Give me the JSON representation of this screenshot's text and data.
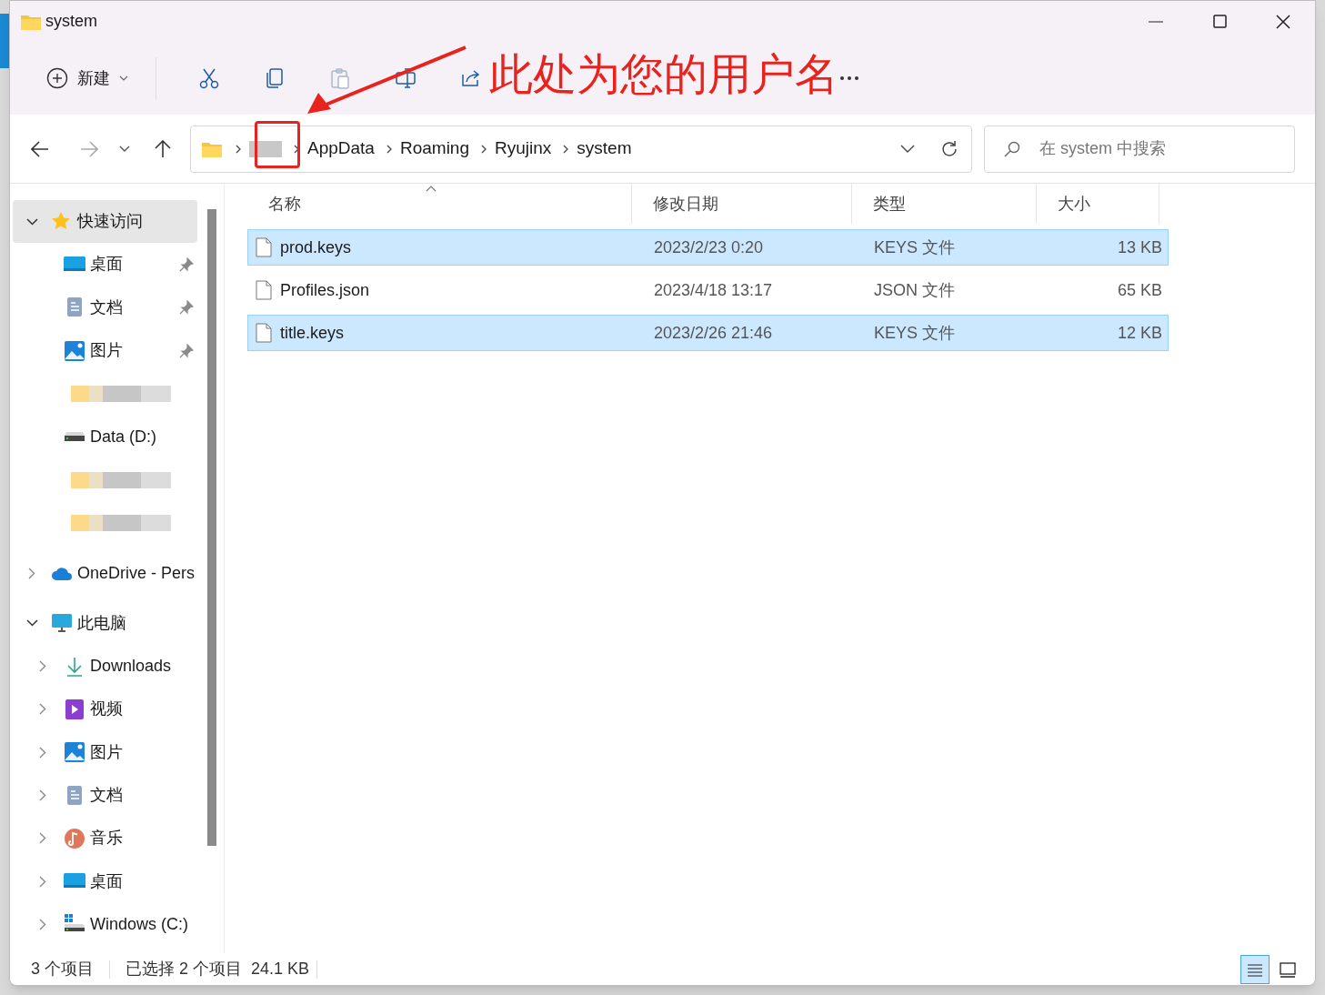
{
  "window": {
    "title": "system"
  },
  "toolbar": {
    "new_button": {
      "label": "新建"
    },
    "tools": [
      {
        "kind": "cut",
        "disabled": false
      },
      {
        "kind": "copy",
        "disabled": false
      },
      {
        "kind": "paste",
        "disabled": true
      },
      {
        "kind": "rename",
        "disabled": false
      },
      {
        "kind": "share",
        "disabled": false
      },
      {
        "kind": "more",
        "disabled": false
      }
    ]
  },
  "annotation": {
    "text": "此处为您的用户名"
  },
  "address_bar": {
    "segments": [
      {
        "kind": "redacted"
      },
      {
        "kind": "text",
        "label": "AppData"
      },
      {
        "kind": "text",
        "label": "Roaming"
      },
      {
        "kind": "text",
        "label": "Ryujinx"
      },
      {
        "kind": "text",
        "label": "system"
      }
    ]
  },
  "search": {
    "placeholder": "在 system 中搜索"
  },
  "sidebar": {
    "items": [
      {
        "kind": "star",
        "label": "快速访问",
        "expanded": true,
        "selected": true,
        "children": [
          {
            "kind": "desktop",
            "label": "桌面",
            "pinned": true,
            "selected": false
          },
          {
            "kind": "document",
            "label": "文档",
            "pinned": true,
            "selected": false
          },
          {
            "kind": "picture",
            "label": "图片",
            "pinned": true,
            "selected": false
          },
          {
            "kind": "redacted"
          },
          {
            "kind": "drive",
            "label": "Data (D:)",
            "pinned": false,
            "selected": false
          },
          {
            "kind": "redacted"
          },
          {
            "kind": "redacted"
          }
        ]
      },
      {
        "kind": "cloud",
        "label": "OneDrive - Pers",
        "expanded": false,
        "selected": false
      },
      {
        "kind": "computer",
        "label": "此电脑",
        "expanded": true,
        "selected": false,
        "children": [
          {
            "kind": "download",
            "label": "Downloads",
            "expanded": false,
            "selected": false
          },
          {
            "kind": "video",
            "label": "视频",
            "expanded": false,
            "selected": false
          },
          {
            "kind": "picture",
            "label": "图片",
            "expanded": false,
            "selected": false
          },
          {
            "kind": "document",
            "label": "文档",
            "expanded": false,
            "selected": false
          },
          {
            "kind": "music",
            "label": "音乐",
            "expanded": false,
            "selected": false
          },
          {
            "kind": "desktop",
            "label": "桌面",
            "expanded": false,
            "selected": false
          },
          {
            "kind": "windows-drive",
            "label": "Windows (C:)",
            "expanded": false,
            "selected": false
          }
        ]
      }
    ]
  },
  "table": {
    "columns": [
      {
        "label": "名称",
        "sorted": true
      },
      {
        "label": "修改日期",
        "sorted": false
      },
      {
        "label": "类型",
        "sorted": false
      },
      {
        "label": "大小",
        "sorted": false
      }
    ],
    "rows": [
      {
        "name": "prod.keys",
        "date": "2023/2/23 0:20",
        "type": "KEYS 文件",
        "size": "13 KB",
        "selected": true
      },
      {
        "name": "Profiles.json",
        "date": "2023/4/18 13:17",
        "type": "JSON 文件",
        "size": "65 KB",
        "selected": false
      },
      {
        "name": "title.keys",
        "date": "2023/2/26 21:46",
        "type": "KEYS 文件",
        "size": "12 KB",
        "selected": true
      }
    ]
  },
  "status_bar": {
    "item_count": "3 个项目",
    "selection": "已选择 2 个项目",
    "selection_size": "24.1 KB",
    "views": [
      {
        "kind": "details",
        "selected": true
      },
      {
        "kind": "tiles",
        "selected": false
      }
    ]
  }
}
